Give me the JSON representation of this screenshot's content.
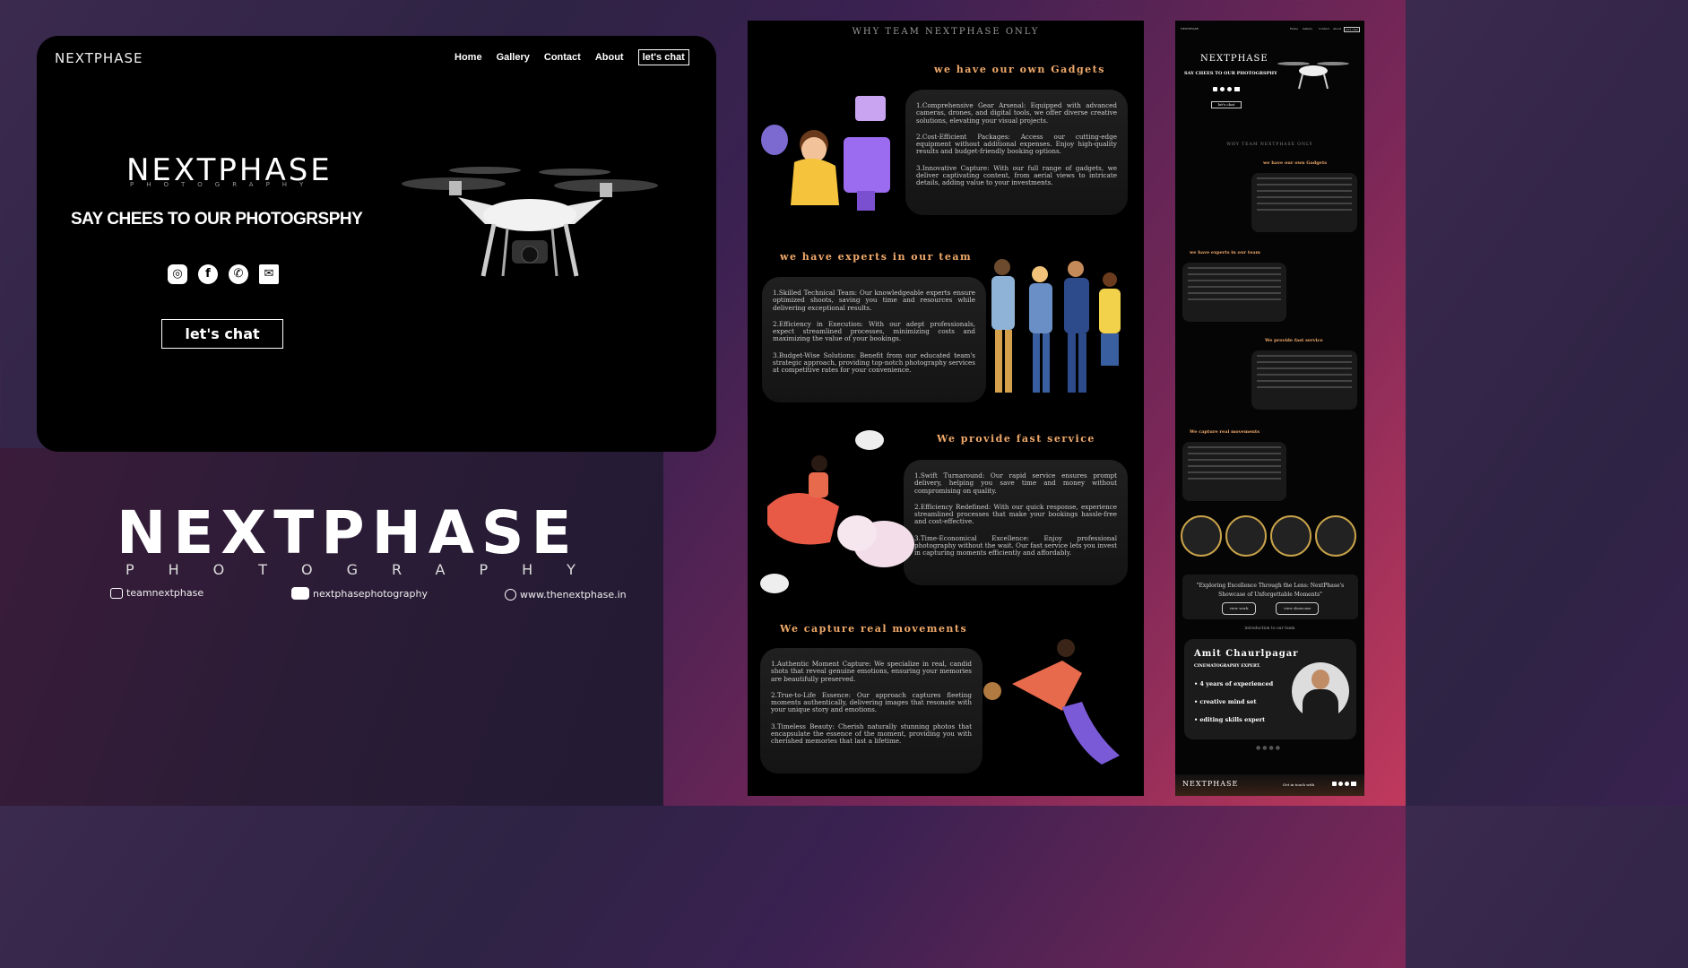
{
  "hero": {
    "nav_logo": "NEXTPHASE",
    "nav": [
      "Home",
      "Gallery",
      "Contact",
      "About"
    ],
    "nav_chat": "let's chat",
    "logo": "NEXTPHASE",
    "logo_sub": "PHOTOGRAPHY",
    "tagline": "SAY CHEES TO OUR PHOTOGRSPHY",
    "cta": "let's chat",
    "social_icons": [
      "instagram-icon",
      "facebook-icon",
      "whatsapp-icon",
      "mail-icon"
    ]
  },
  "brand": {
    "name": "NEXTPHASE",
    "sub": "PHOTOGRAPHY",
    "instagram": "teamnextphase",
    "youtube": "nextphasephotography",
    "website": "www.thenextphase.in"
  },
  "panel": {
    "title": "WHY TEAM NEXTPHASE ONLY",
    "sections": [
      {
        "heading": "we have our own Gadgets",
        "items": [
          "1.Comprehensive Gear Arsenal: Equipped with advanced cameras, drones, and digital tools, we offer diverse creative solutions, elevating your visual projects.",
          "2.Cost-Efficient Packages: Access our cutting-edge equipment without additional expenses. Enjoy high-quality results and budget-friendly booking options.",
          "3.Innovative Capture: With our full range of gadgets, we deliver captivating content, from aerial views to intricate details, adding value to your investments."
        ]
      },
      {
        "heading": "we have experts in our team",
        "items": [
          "1.Skilled Technical Team: Our knowledgeable experts ensure optimized shoots, saving you time and resources while delivering exceptional results.",
          "2.Efficiency in Execution: With our adept professionals, expect streamlined processes, minimizing costs and maximizing the value of your bookings.",
          "3.Budget-Wise Solutions: Benefit from our educated team's strategic approach, providing top-notch photography services at competitive rates for your convenience."
        ]
      },
      {
        "heading": "We provide fast service",
        "items": [
          "1.Swift Turnaround: Our rapid service ensures prompt delivery, helping you save time and money without compromising on quality.",
          "2.Efficiency Redefined: With our quick response, experience streamlined processes that make your bookings hassle-free and cost-effective.",
          "3.Time-Economical Excellence: Enjoy professional photography without the wait. Our fast service lets you invest in capturing moments efficiently and affordably."
        ]
      },
      {
        "heading": "We capture real movements",
        "items": [
          "1.Authentic Moment Capture: We specialize in real, candid shots that reveal genuine emotions, ensuring your memories are beautifully preserved.",
          "2.True-to-Life Essence: Our approach captures fleeting moments authentically, delivering images that resonate with your unique story and emotions.",
          "3.Timeless Beauty: Cherish naturally stunning photos that encapsulate the essence of the moment, providing you with cherished memories that last a lifetime."
        ]
      }
    ]
  },
  "mini": {
    "nav_logo": "NEXTPHASE",
    "nav": [
      "Home",
      "Gallery",
      "Contact",
      "About"
    ],
    "nav_chat": "let's chat",
    "logo": "NEXTPHASE",
    "tagline": "SAY CHEES TO OUR PHOTOGRSPHY",
    "cta": "let's chat",
    "title": "WHY TEAM NEXTPHASE ONLY",
    "headings": [
      "we have our own Gadgets",
      "we have experts in our team",
      "We provide fast service",
      "We capture real movements"
    ],
    "quote": "\"Exploring Excellence Through the Lens: NextPhase's Showcase of Unforgettable Moments\"",
    "btn_work": "view work",
    "btn_showcase": "view showcase",
    "intro": "introduction to our team",
    "expert_name": "Amit Chaurlpagar",
    "expert_title": "CINEMATOGRAPHY EXPERT.",
    "expert_points": [
      "• 4 years of experienced",
      "• creative mind set",
      "• editing skills expert"
    ],
    "footer_logo": "NEXTPHASE",
    "footer_text": "Get in touch with"
  }
}
